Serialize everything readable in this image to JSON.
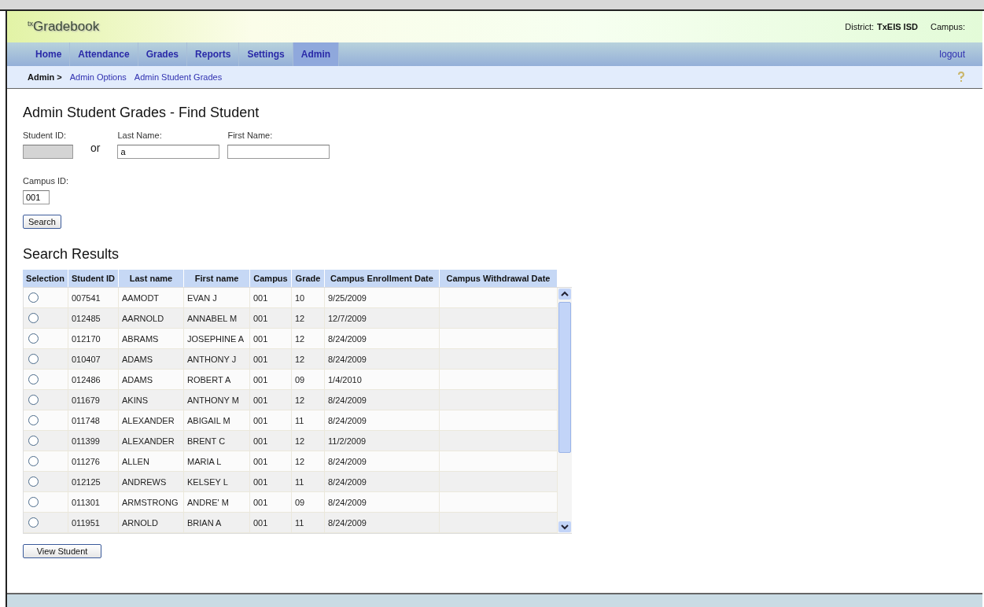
{
  "app": {
    "logo_prefix": "tx",
    "logo": "Gradebook",
    "district_label": "District:",
    "district": "TxEIS ISD",
    "campus_label": "Campus:"
  },
  "nav": {
    "tabs": [
      {
        "label": "Home",
        "selected": false
      },
      {
        "label": "Attendance",
        "selected": false
      },
      {
        "label": "Grades",
        "selected": false
      },
      {
        "label": "Reports",
        "selected": false
      },
      {
        "label": "Settings",
        "selected": false
      },
      {
        "label": "Admin",
        "selected": true
      }
    ],
    "logout": "logout"
  },
  "breadcrumb": {
    "root": "Admin >",
    "links": [
      "Admin Options",
      "Admin Student Grades"
    ]
  },
  "page_title": "Admin Student Grades - Find Student",
  "form": {
    "student_id": {
      "label": "Student ID:",
      "disabled": true
    },
    "or": "or",
    "last_name": {
      "label": "Last Name:",
      "value": "a"
    },
    "first_name": {
      "label": "First Name:"
    },
    "campus_id": {
      "label": "Campus ID:",
      "value": "001"
    },
    "search_button": "Search"
  },
  "results": {
    "title": "Search Results",
    "columns": [
      "Selection",
      "Student ID",
      "Last name",
      "First name",
      "Campus",
      "Grade",
      "Campus Enrollment Date",
      "Campus Withdrawal Date"
    ],
    "rows": [
      {
        "selected": false,
        "cells": [
          "",
          "007541",
          "AAMODT",
          "EVAN J",
          "001",
          "10",
          "9/25/2009"
        ]
      },
      {
        "selected": false,
        "cells": [
          "",
          "012485",
          "AARNOLD",
          "ANNABEL M",
          "001",
          "12",
          "12/7/2009"
        ]
      },
      {
        "selected": false,
        "cells": [
          "",
          "012170",
          "ABRAMS",
          "JOSEPHINE A",
          "001",
          "12",
          "8/24/2009"
        ]
      },
      {
        "selected": false,
        "cells": [
          "",
          "010407",
          "ADAMS",
          "ANTHONY J",
          "001",
          "12",
          "8/24/2009"
        ]
      },
      {
        "selected": false,
        "cells": [
          "",
          "012486",
          "ADAMS",
          "ROBERT A",
          "001",
          "09",
          "1/4/2010"
        ]
      },
      {
        "selected": false,
        "cells": [
          "",
          "011679",
          "AKINS",
          "ANTHONY M",
          "001",
          "12",
          "8/24/2009"
        ]
      },
      {
        "selected": false,
        "cells": [
          "",
          "011748",
          "ALEXANDER",
          "ABIGAIL M",
          "001",
          "11",
          "8/24/2009"
        ]
      },
      {
        "selected": false,
        "cells": [
          "",
          "011399",
          "ALEXANDER",
          "BRENT C",
          "001",
          "12",
          "11/2/2009"
        ]
      },
      {
        "selected": false,
        "cells": [
          "",
          "011276",
          "ALLEN",
          "MARIA L",
          "001",
          "12",
          "8/24/2009"
        ]
      },
      {
        "selected": false,
        "cells": [
          "",
          "012125",
          "ANDREWS",
          "KELSEY L",
          "001",
          "11",
          "8/24/2009"
        ]
      },
      {
        "selected": false,
        "cells": [
          "",
          "011301",
          "ARMSTRONG",
          "ANDRE' M",
          "001",
          "09",
          "8/24/2009"
        ]
      },
      {
        "selected": false,
        "cells": [
          "",
          "011951",
          "ARNOLD",
          "BRIAN A",
          "001",
          "11",
          "8/24/2009"
        ]
      }
    ],
    "view_button": "View Student"
  }
}
